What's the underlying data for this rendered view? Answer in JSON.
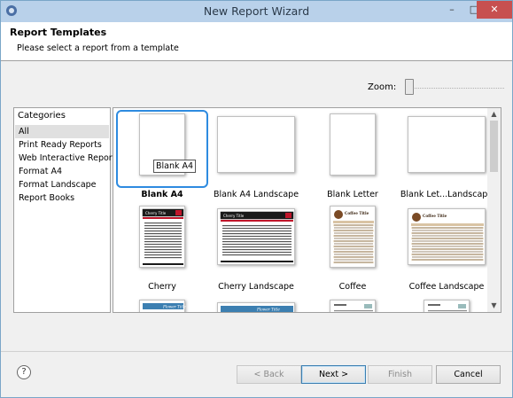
{
  "window": {
    "title": "New Report Wizard",
    "min_glyph": "–",
    "max_glyph": "□",
    "close_glyph": "✕"
  },
  "header": {
    "title": "Report Templates",
    "description": "Please select a report from a template"
  },
  "zoom": {
    "label": "Zoom:",
    "level": 0.0
  },
  "categories": {
    "header": "Categories",
    "items": [
      {
        "label": "All",
        "selected": true
      },
      {
        "label": "Print Ready Reports"
      },
      {
        "label": "Web Interactive Reports"
      },
      {
        "label": "Format A4"
      },
      {
        "label": "Format Landscape"
      },
      {
        "label": "Report Books"
      }
    ]
  },
  "templates": {
    "items": [
      {
        "label": "Blank A4",
        "kind": "blank-portrait",
        "selected": true,
        "tooltip": "Blank A4"
      },
      {
        "label": "Blank A4 Landscape",
        "kind": "blank-landscape"
      },
      {
        "label": "Blank Letter",
        "kind": "blank-portrait"
      },
      {
        "label": "Blank Let...Landscape",
        "kind": "blank-landscape"
      },
      {
        "label": "Cherry",
        "kind": "cherry-portrait",
        "thumb_title": "Cherry Title"
      },
      {
        "label": "Cherry Landscape",
        "kind": "cherry-landscape",
        "thumb_title": "Cherry Title"
      },
      {
        "label": "Coffee",
        "kind": "coffee-portrait",
        "thumb_title": "Coffee Title"
      },
      {
        "label": "Coffee Landscape",
        "kind": "coffee-landscape",
        "thumb_title": "Coffee Title"
      },
      {
        "label": "",
        "kind": "flower-portrait",
        "thumb_title": "Flower Title"
      },
      {
        "label": "",
        "kind": "flower-landscape",
        "thumb_title": "Flower Title"
      },
      {
        "label": "",
        "kind": "plain-portrait"
      },
      {
        "label": "",
        "kind": "plain-portrait"
      }
    ]
  },
  "buttons": {
    "help": "?",
    "back": "< Back",
    "next": "Next >",
    "finish": "Finish",
    "cancel": "Cancel"
  },
  "colors": {
    "titlebar": "#b9d1ea",
    "close": "#c75050",
    "selection": "#2e8be0",
    "cherry": "#c0162b",
    "coffee": "#7a4a25",
    "flower": "#3c7fb1"
  },
  "icons": {
    "help": "help-icon",
    "app": "wizard-app-icon"
  }
}
